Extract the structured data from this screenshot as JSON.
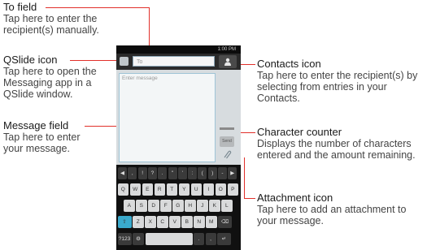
{
  "callouts": {
    "to_field": {
      "title": "To field",
      "desc_lines": [
        "Tap here to enter the",
        "recipient(s) manually."
      ]
    },
    "qslide": {
      "title": "QSlide icon",
      "desc_lines": [
        "Tap here to open the",
        "Messaging app in a",
        "QSlide window."
      ]
    },
    "message": {
      "title": "Message field",
      "desc_lines": [
        "Tap here to enter",
        "your message."
      ]
    },
    "contacts": {
      "title": "Contacts icon",
      "desc_lines": [
        "Tap here to enter the recipient(s) by",
        "selecting from entries in your",
        "Contacts."
      ]
    },
    "counter": {
      "title": "Character counter",
      "desc_lines": [
        "Displays the number of characters",
        "entered and the amount remaining."
      ]
    },
    "attachment": {
      "title": "Attachment icon",
      "desc_lines": [
        "Tap here to add an attachment to",
        "your message."
      ]
    }
  },
  "phone": {
    "status_time": "1:00 PM",
    "to_placeholder": "To",
    "message_placeholder": "Enter message",
    "send_label": "Send",
    "keyboard_rows": [
      [
        "◀",
        ",",
        "!",
        "?",
        ".",
        "\"",
        "'",
        ":",
        "(",
        ")",
        "-",
        "▶"
      ],
      [
        "Q",
        "W",
        "E",
        "R",
        "T",
        "Y",
        "U",
        "I",
        "O",
        "P"
      ],
      [
        "A",
        "S",
        "D",
        "F",
        "G",
        "H",
        "J",
        "K",
        "L"
      ],
      [
        "⇧",
        "Z",
        "X",
        "C",
        "V",
        "B",
        "N",
        "M",
        "⌫"
      ],
      [
        "?123",
        "⚙",
        " ",
        ".",
        ",",
        "↵"
      ]
    ]
  },
  "colors": {
    "callout_line": "#e1302a",
    "accent_key": "#3aa9cc",
    "field_border": "#9fc4d6"
  }
}
